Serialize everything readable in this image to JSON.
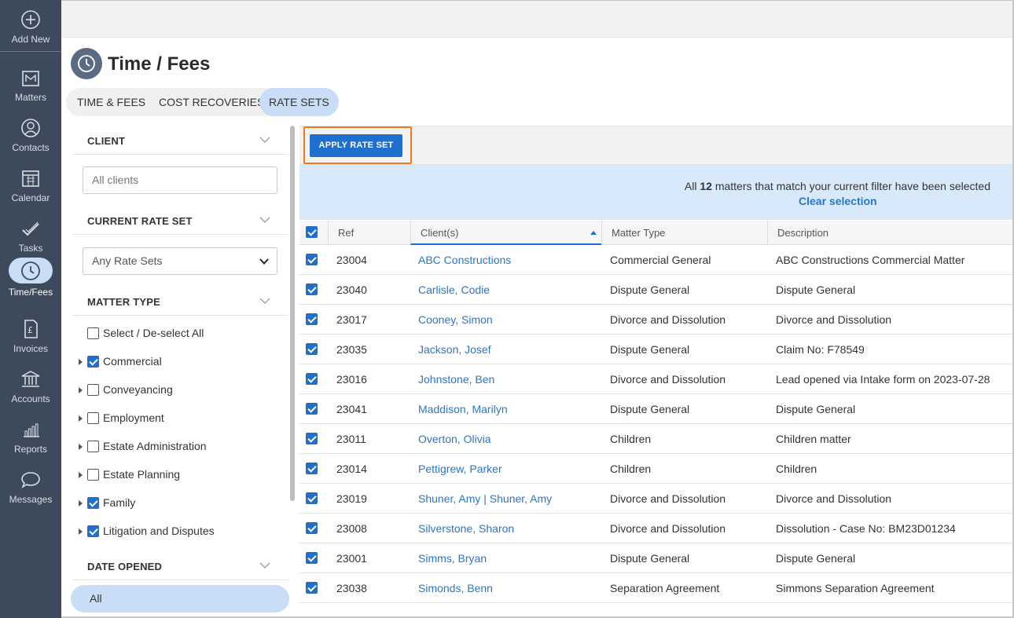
{
  "nav": {
    "items": [
      {
        "label": "Add New",
        "icon": "plus-circle-icon"
      },
      {
        "label": "Matters",
        "icon": "matters-folder-icon"
      },
      {
        "label": "Contacts",
        "icon": "contacts-icon"
      },
      {
        "label": "Calendar",
        "icon": "calendar-icon"
      },
      {
        "label": "Tasks",
        "icon": "tasks-icon"
      },
      {
        "label": "Time/Fees",
        "icon": "clock-icon"
      },
      {
        "label": "Invoices",
        "icon": "invoice-icon"
      },
      {
        "label": "Accounts",
        "icon": "bank-icon"
      },
      {
        "label": "Reports",
        "icon": "bar-chart-icon"
      },
      {
        "label": "Messages",
        "icon": "chat-bubble-icon"
      }
    ],
    "active": "Time/Fees"
  },
  "page": {
    "title": "Time / Fees",
    "tabs": [
      "TIME & FEES",
      "COST RECOVERIES",
      "RATE SETS"
    ],
    "active_tab": "RATE SETS"
  },
  "filters": {
    "client": {
      "heading": "CLIENT",
      "placeholder": "All clients"
    },
    "rate_set": {
      "heading": "CURRENT RATE SET",
      "value": "Any Rate Sets"
    },
    "matter_type": {
      "heading": "MATTER TYPE",
      "select_all": "Select / De-select All",
      "items": [
        {
          "label": "Commercial",
          "checked": true
        },
        {
          "label": "Conveyancing",
          "checked": false
        },
        {
          "label": "Employment",
          "checked": false
        },
        {
          "label": "Estate Administration",
          "checked": false
        },
        {
          "label": "Estate Planning",
          "checked": false
        },
        {
          "label": "Family",
          "checked": true
        },
        {
          "label": "Litigation and Disputes",
          "checked": true
        }
      ]
    },
    "date_opened": {
      "heading": "DATE OPENED",
      "value": "All"
    }
  },
  "toolbar": {
    "apply_label": "APPLY RATE SET"
  },
  "banner": {
    "prefix": "All ",
    "count": "12",
    "suffix": " matters that match your current filter have been selected",
    "clear_label": "Clear selection"
  },
  "table": {
    "columns": [
      "Ref",
      "Client(s)",
      "Matter Type",
      "Description"
    ],
    "sorted_column": "Client(s)",
    "rows": [
      {
        "ref": "23004",
        "client": "ABC Constructions",
        "type": "Commercial General",
        "desc": "ABC Constructions Commercial Matter"
      },
      {
        "ref": "23040",
        "client": "Carlisle, Codie",
        "type": "Dispute General",
        "desc": "Dispute General"
      },
      {
        "ref": "23017",
        "client": "Cooney, Simon",
        "type": "Divorce and Dissolution",
        "desc": "Divorce and Dissolution"
      },
      {
        "ref": "23035",
        "client": "Jackson, Josef",
        "type": "Dispute General",
        "desc": "Claim No: F78549"
      },
      {
        "ref": "23016",
        "client": "Johnstone, Ben",
        "type": "Divorce and Dissolution",
        "desc": "Lead opened via Intake form on 2023-07-28"
      },
      {
        "ref": "23041",
        "client": "Maddison, Marilyn",
        "type": "Dispute General",
        "desc": "Dispute General"
      },
      {
        "ref": "23011",
        "client": "Overton, Olivia",
        "type": "Children",
        "desc": "Children matter"
      },
      {
        "ref": "23014",
        "client": "Pettigrew, Parker",
        "type": "Children",
        "desc": "Children"
      },
      {
        "ref": "23019",
        "client": "Shuner, Amy | Shuner, Amy",
        "type": "Divorce and Dissolution",
        "desc": "Divorce and Dissolution"
      },
      {
        "ref": "23008",
        "client": "Silverstone, Sharon",
        "type": "Divorce and Dissolution",
        "desc": "Dissolution - Case No: BM23D01234"
      },
      {
        "ref": "23001",
        "client": "Simms, Bryan",
        "type": "Dispute General",
        "desc": "Dispute General"
      },
      {
        "ref": "23038",
        "client": "Simonds, Benn",
        "type": "Separation Agreement",
        "desc": "Simmons Separation Agreement"
      }
    ]
  },
  "colors": {
    "nav_bg": "#3d4a5c",
    "accent": "#1f6fcf",
    "highlight": "#f07a1a",
    "banner": "#d8e9fb",
    "pill": "#c9ddf7"
  }
}
